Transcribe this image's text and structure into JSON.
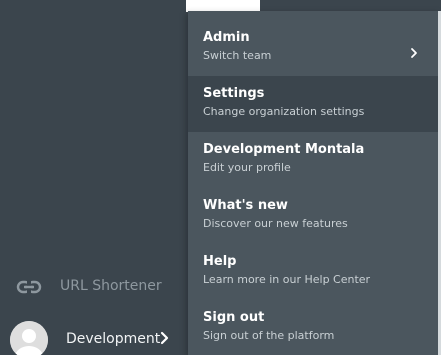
{
  "sidebar": {
    "url_shortener": {
      "label": "URL Shortener",
      "icon": "link-icon"
    },
    "user": {
      "name": "Development",
      "icon": "chevron-right-icon",
      "avatar": "avatar"
    }
  },
  "menu": {
    "items": [
      {
        "title": "Admin",
        "subtitle": "Switch team",
        "has_chevron": true
      },
      {
        "title": "Settings",
        "subtitle": "Change organization settings",
        "active": true
      },
      {
        "title": "Development Montala",
        "subtitle": "Edit your profile"
      },
      {
        "title": "What's new",
        "subtitle": "Discover our new features"
      },
      {
        "title": "Help",
        "subtitle": "Learn more in our Help Center"
      },
      {
        "title": "Sign out",
        "subtitle": "Sign out of the platform"
      }
    ]
  },
  "colors": {
    "sidebar_bg": "#3b454d",
    "menu_bg": "#4b565e",
    "menu_active_bg": "#3b454d"
  }
}
